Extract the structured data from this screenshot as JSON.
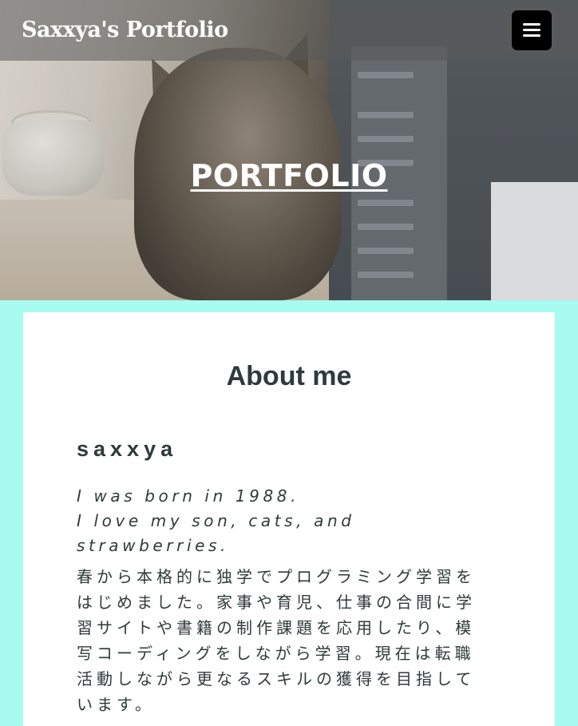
{
  "header": {
    "site_title": "Saxxya's Portfolio",
    "menu_icon": "hamburger-menu-icon"
  },
  "hero": {
    "title": "PORTFOLIO"
  },
  "about": {
    "heading": "About me",
    "name": "saxxya",
    "intro_lines": [
      "I was born in 1988.",
      "I love my son, cats, and strawberries."
    ],
    "bio": "春から本格的に独学でプログラミング学習をはじめました。家事や育児、仕事の合間に学習サイトや書籍の制作課題を応用したり、模写コーディングをしながら学習。現在は転職活動しながら更なるスキルの獲得を目指しています。"
  },
  "colors": {
    "page_background": "#a8fbf1",
    "card_background": "#ffffff",
    "text": "#2f3a3a",
    "menu_button": "#000000"
  }
}
